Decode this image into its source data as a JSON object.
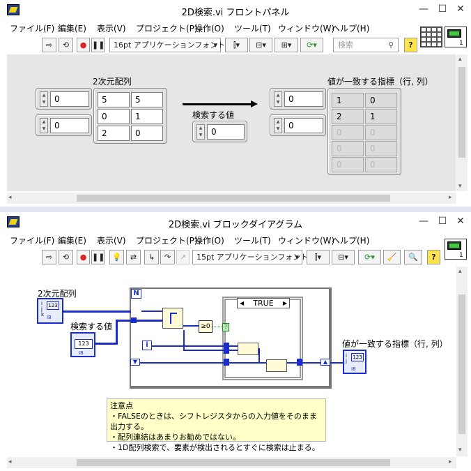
{
  "front_panel": {
    "title": "2D検索.vi フロントパネル",
    "menu": [
      "ファイル(F)",
      "編集(E)",
      "表示(V)",
      "プロジェクト(P)",
      "操作(O)",
      "ツール(T)",
      "ウィンドウ(W)",
      "ヘルプ(H)"
    ],
    "font": "16pt アプリケーションフォント",
    "search_placeholder": "検索",
    "array_label": "2次元配列",
    "array_index": [
      "0",
      "0"
    ],
    "array_values": [
      [
        "5",
        "5"
      ],
      [
        "0",
        "1"
      ],
      [
        "2",
        "0"
      ]
    ],
    "search_label": "検索する値",
    "search_value": "0",
    "result_label": "値が一致する指標（行, 列）",
    "result_index": [
      "0",
      "0"
    ],
    "result_values": [
      [
        "1",
        "0"
      ],
      [
        "2",
        "1"
      ],
      [
        "0",
        "0"
      ],
      [
        "0",
        "0"
      ],
      [
        "0",
        "0"
      ]
    ]
  },
  "block_diagram": {
    "title": "2D検索.vi ブロックダイアグラム",
    "menu": [
      "ファイル(F)",
      "編集(E)",
      "表示(V)",
      "プロジェクト(P)",
      "操作(O)",
      "ツール(T)",
      "ウィンドウ(W)",
      "ヘルプ(H)"
    ],
    "font": "15pt アプリケーションフォント",
    "array_terminal_label": "2次元配列",
    "search_terminal_label": "検索する値",
    "result_terminal_label": "値が一致する指標（行, 列）",
    "loop_count": "N",
    "loop_index": "i",
    "case_value": "TRUE",
    "terminal_type": "I8",
    "num_glyph": "123",
    "bool_glyph": "?",
    "note": {
      "title": "注意点",
      "lines": [
        "・FALSEのときは、シフトレジスタからの入力値をそのまま出力する。",
        "・配列連結はあまりお勧めではない。",
        "・1D配列検索で、要素が検出されるとすぐに検索は止まる。"
      ]
    }
  }
}
